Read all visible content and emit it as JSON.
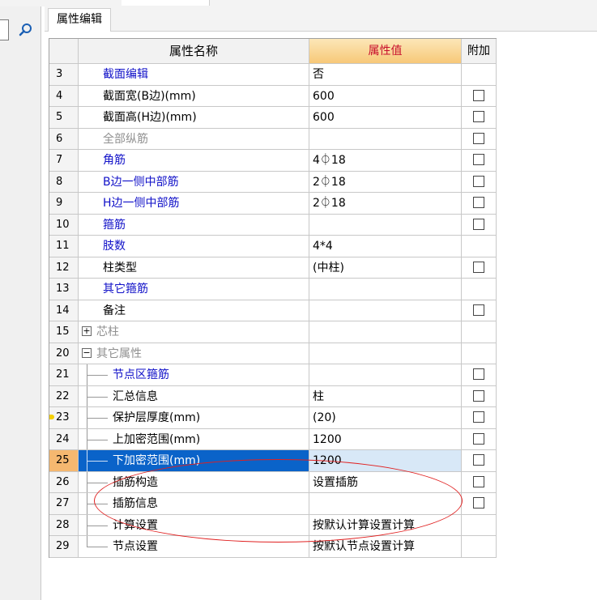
{
  "tab": {
    "label": "属性编辑"
  },
  "header": {
    "num": "",
    "name": "属性名称",
    "value": "属性值",
    "extra": "附加"
  },
  "rows": [
    {
      "num": "3",
      "name": "截面编辑",
      "value": "否",
      "color": "blue",
      "check": false,
      "indent": 0
    },
    {
      "num": "4",
      "name": "截面宽(B边)(mm)",
      "value": "600",
      "color": "black",
      "check": true,
      "indent": 0
    },
    {
      "num": "5",
      "name": "截面高(H边)(mm)",
      "value": "600",
      "color": "black",
      "check": true,
      "indent": 0
    },
    {
      "num": "6",
      "name": "全部纵筋",
      "value": "",
      "color": "gray",
      "check": true,
      "indent": 0
    },
    {
      "num": "7",
      "name": "角筋",
      "value": "4⏀18",
      "color": "blue",
      "check": true,
      "indent": 0
    },
    {
      "num": "8",
      "name": "B边一侧中部筋",
      "value": "2⏀18",
      "color": "blue",
      "check": true,
      "indent": 0
    },
    {
      "num": "9",
      "name": "H边一侧中部筋",
      "value": "2⏀18",
      "color": "blue",
      "check": true,
      "indent": 0
    },
    {
      "num": "10",
      "name": "箍筋",
      "value": "",
      "color": "blue",
      "check": true,
      "indent": 0
    },
    {
      "num": "11",
      "name": "肢数",
      "value": "4*4",
      "color": "blue",
      "check": false,
      "indent": 0
    },
    {
      "num": "12",
      "name": "柱类型",
      "value": "(中柱)",
      "color": "black",
      "check": true,
      "indent": 0
    },
    {
      "num": "13",
      "name": "其它箍筋",
      "value": "",
      "color": "blue",
      "check": false,
      "indent": 0
    },
    {
      "num": "14",
      "name": "备注",
      "value": "",
      "color": "black",
      "check": true,
      "indent": 0
    },
    {
      "num": "15",
      "name": "芯柱",
      "value": "",
      "color": "gray",
      "check": false,
      "indent": 0,
      "expander": "+"
    },
    {
      "num": "20",
      "name": "其它属性",
      "value": "",
      "color": "gray",
      "check": false,
      "indent": 0,
      "expander": "−"
    },
    {
      "num": "21",
      "name": "节点区箍筋",
      "value": "",
      "color": "blue",
      "check": true,
      "indent": 1
    },
    {
      "num": "22",
      "name": "汇总信息",
      "value": "柱",
      "color": "black",
      "check": true,
      "indent": 1
    },
    {
      "num": "23",
      "name": "保护层厚度(mm)",
      "value": "(20)",
      "color": "black",
      "check": true,
      "indent": 1,
      "marker": true
    },
    {
      "num": "24",
      "name": "上加密范围(mm)",
      "value": "1200",
      "color": "black",
      "check": true,
      "indent": 1
    },
    {
      "num": "25",
      "name": "下加密范围(mm)",
      "value": "1200",
      "color": "black",
      "check": true,
      "indent": 1,
      "selected": true
    },
    {
      "num": "26",
      "name": "插筋构造",
      "value": "设置插筋",
      "color": "black",
      "check": true,
      "indent": 1
    },
    {
      "num": "27",
      "name": "插筋信息",
      "value": "",
      "color": "black",
      "check": true,
      "indent": 1
    },
    {
      "num": "28",
      "name": "计算设置",
      "value": "按默认计算设置计算",
      "color": "black",
      "check": false,
      "indent": 1
    },
    {
      "num": "29",
      "name": "节点设置",
      "value": "按默认节点设置计算",
      "color": "black",
      "check": false,
      "indent": 1,
      "last": true
    }
  ],
  "colors": {
    "selection": "#0a63c9",
    "header_value_text": "#c8102e",
    "highlight_oval": "#e02020"
  }
}
